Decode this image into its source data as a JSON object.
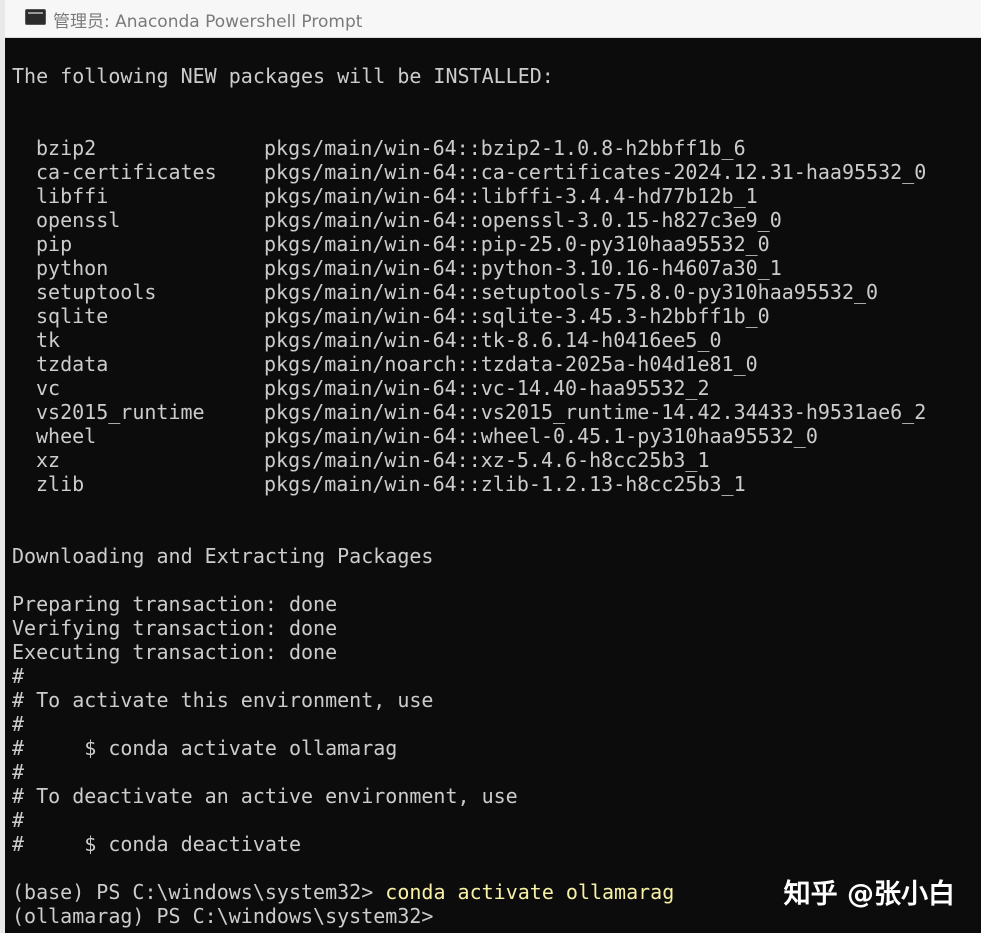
{
  "window": {
    "title": "管理员: Anaconda Powershell Prompt"
  },
  "terminal": {
    "install_header": "The following NEW packages will be INSTALLED:",
    "packages": [
      {
        "name": "bzip2",
        "spec": "pkgs/main/win-64::bzip2-1.0.8-h2bbff1b_6"
      },
      {
        "name": "ca-certificates",
        "spec": "pkgs/main/win-64::ca-certificates-2024.12.31-haa95532_0"
      },
      {
        "name": "libffi",
        "spec": "pkgs/main/win-64::libffi-3.4.4-hd77b12b_1"
      },
      {
        "name": "openssl",
        "spec": "pkgs/main/win-64::openssl-3.0.15-h827c3e9_0"
      },
      {
        "name": "pip",
        "spec": "pkgs/main/win-64::pip-25.0-py310haa95532_0"
      },
      {
        "name": "python",
        "spec": "pkgs/main/win-64::python-3.10.16-h4607a30_1"
      },
      {
        "name": "setuptools",
        "spec": "pkgs/main/win-64::setuptools-75.8.0-py310haa95532_0"
      },
      {
        "name": "sqlite",
        "spec": "pkgs/main/win-64::sqlite-3.45.3-h2bbff1b_0"
      },
      {
        "name": "tk",
        "spec": "pkgs/main/win-64::tk-8.6.14-h0416ee5_0"
      },
      {
        "name": "tzdata",
        "spec": "pkgs/main/noarch::tzdata-2025a-h04d1e81_0"
      },
      {
        "name": "vc",
        "spec": "pkgs/main/win-64::vc-14.40-haa95532_2"
      },
      {
        "name": "vs2015_runtime",
        "spec": "pkgs/main/win-64::vs2015_runtime-14.42.34433-h9531ae6_2"
      },
      {
        "name": "wheel",
        "spec": "pkgs/main/win-64::wheel-0.45.1-py310haa95532_0"
      },
      {
        "name": "xz",
        "spec": "pkgs/main/win-64::xz-5.4.6-h8cc25b3_1"
      },
      {
        "name": "zlib",
        "spec": "pkgs/main/win-64::zlib-1.2.13-h8cc25b3_1"
      }
    ],
    "downloading": "Downloading and Extracting Packages",
    "preparing": "Preparing transaction: done",
    "verifying": "Verifying transaction: done",
    "executing": "Executing transaction: done",
    "hash_1": "#",
    "activate_note": "# To activate this environment, use",
    "hash_2": "#",
    "activate_cmd": "#     $ conda activate ollamarag",
    "hash_3": "#",
    "deactivate_note": "# To deactivate an active environment, use",
    "hash_4": "#",
    "deactivate_cmd": "#     $ conda deactivate",
    "prompt_1": "(base) PS C:\\windows\\system32>",
    "command_1": "conda activate ollamarag",
    "prompt_2": "(ollamarag) PS C:\\windows\\system32>"
  },
  "watermark": {
    "text": "知乎 @张小白"
  }
}
